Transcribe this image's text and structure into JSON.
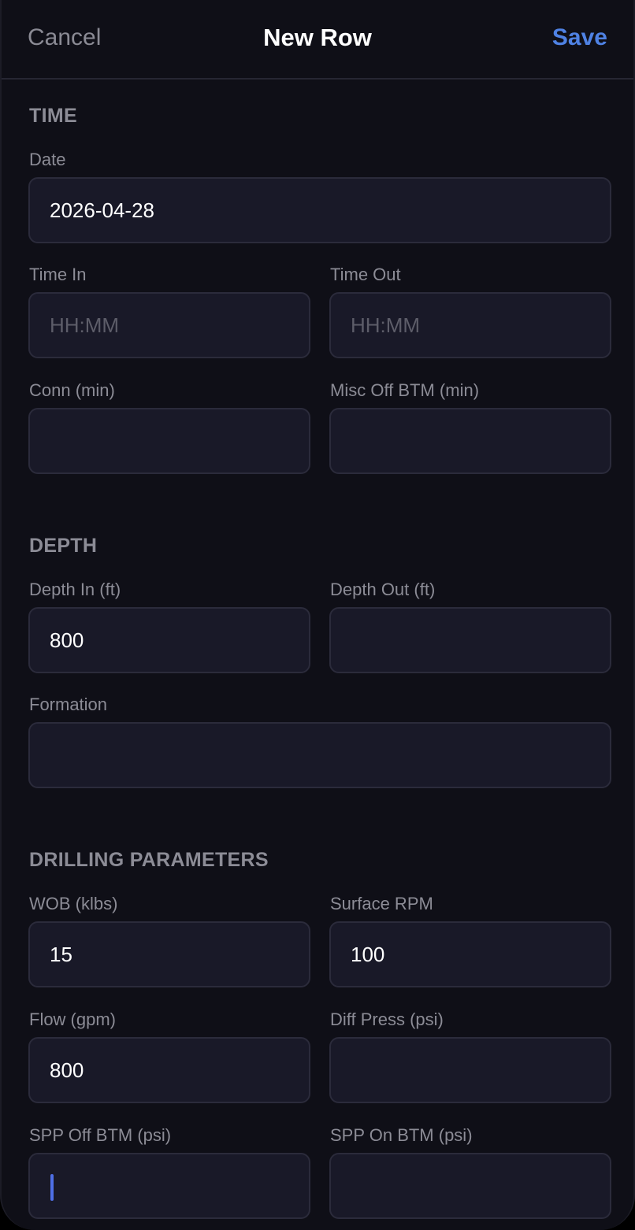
{
  "header": {
    "cancel_label": "Cancel",
    "title": "New Row",
    "save_label": "Save"
  },
  "sections": {
    "time": {
      "title": "TIME",
      "date": {
        "label": "Date",
        "value": "2026-04-28"
      },
      "time_in": {
        "label": "Time In",
        "value": "",
        "placeholder": "HH:MM"
      },
      "time_out": {
        "label": "Time Out",
        "value": "",
        "placeholder": "HH:MM"
      },
      "conn": {
        "label": "Conn (min)",
        "value": ""
      },
      "misc_off_btm": {
        "label": "Misc Off BTM (min)",
        "value": ""
      }
    },
    "depth": {
      "title": "DEPTH",
      "depth_in": {
        "label": "Depth In (ft)",
        "value": "800"
      },
      "depth_out": {
        "label": "Depth Out (ft)",
        "value": ""
      },
      "formation": {
        "label": "Formation",
        "value": ""
      }
    },
    "drilling": {
      "title": "DRILLING PARAMETERS",
      "wob": {
        "label": "WOB (klbs)",
        "value": "15"
      },
      "surface_rpm": {
        "label": "Surface RPM",
        "value": "100"
      },
      "flow": {
        "label": "Flow (gpm)",
        "value": "800"
      },
      "diff_press": {
        "label": "Diff Press (psi)",
        "value": ""
      },
      "spp_off_btm": {
        "label": "SPP Off BTM (psi)",
        "value": ""
      },
      "spp_on_btm": {
        "label": "SPP On BTM (psi)",
        "value": ""
      }
    }
  },
  "colors": {
    "accent": "#4f82e4",
    "background": "#0f0f17",
    "field_background": "#191928",
    "label": "#8c8c96"
  }
}
